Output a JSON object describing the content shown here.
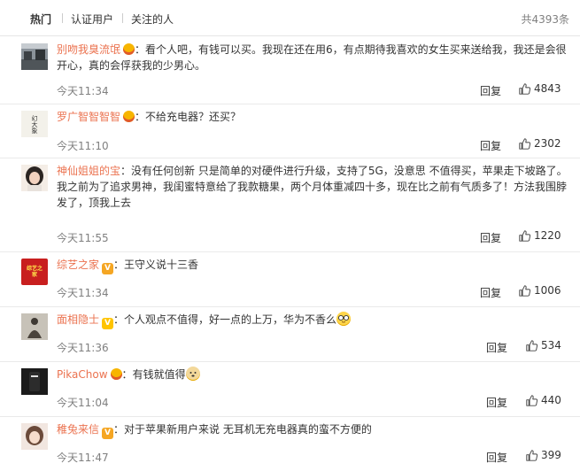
{
  "tabs": [
    "热门",
    "认证用户",
    "关注的人"
  ],
  "total_label": "共4393条",
  "reply_label": "回复",
  "colon": "：",
  "comments": [
    {
      "user": "别吻我臭流氓",
      "badge": "crown",
      "text": "看个人吧，有钱可以买。我现在还在用6，有点期待我喜欢的女生买来送给我，我还是会很开心，真的会俘获我的少男心。",
      "time": "今天11:34",
      "likes": "4843"
    },
    {
      "user": "罗广智智智智",
      "badge": "crown",
      "text": "不给充电器？还买？",
      "time": "今天11:10",
      "likes": "2302"
    },
    {
      "user": "神仙姐姐的宝",
      "badge": "none",
      "text": "没有任何创新 只是简单的对硬件进行升级，支持了5G，没意思 不值得买，苹果走下坡路了。我之前为了追求男神，我闺蜜特意给了我款糖果，两个月体重减四十多，现在比之前有气质多了！方法我围脖发了，顶我上去",
      "time": "今天11:55",
      "likes": "1220"
    },
    {
      "user": "综艺之家",
      "badge": "vip",
      "text": "王守义说十三香",
      "time": "今天11:34",
      "likes": "1006"
    },
    {
      "user": "面相隐士",
      "badge": "vip-yellow",
      "text": "个人观点不值得，好一点的上万，华为不香么",
      "time": "今天11:36",
      "likes": "534",
      "emoji": "glasses-emoji"
    },
    {
      "user": "PikaChow",
      "badge": "crown",
      "text": "有钱就值得",
      "time": "今天11:04",
      "likes": "440",
      "emoji": "doge-emoji"
    },
    {
      "user": "稚兔来信",
      "badge": "vip",
      "text": "对于苹果新用户来说 无耳机无充电器真的蛮不方便的",
      "time": "今天11:47",
      "likes": "399"
    }
  ],
  "avatar_texts": {
    "c1": "幻大象",
    "c3": "综艺之家"
  },
  "colors": {
    "username": "#eb7350",
    "meta": "#808080",
    "divider": "#eaeaea"
  }
}
